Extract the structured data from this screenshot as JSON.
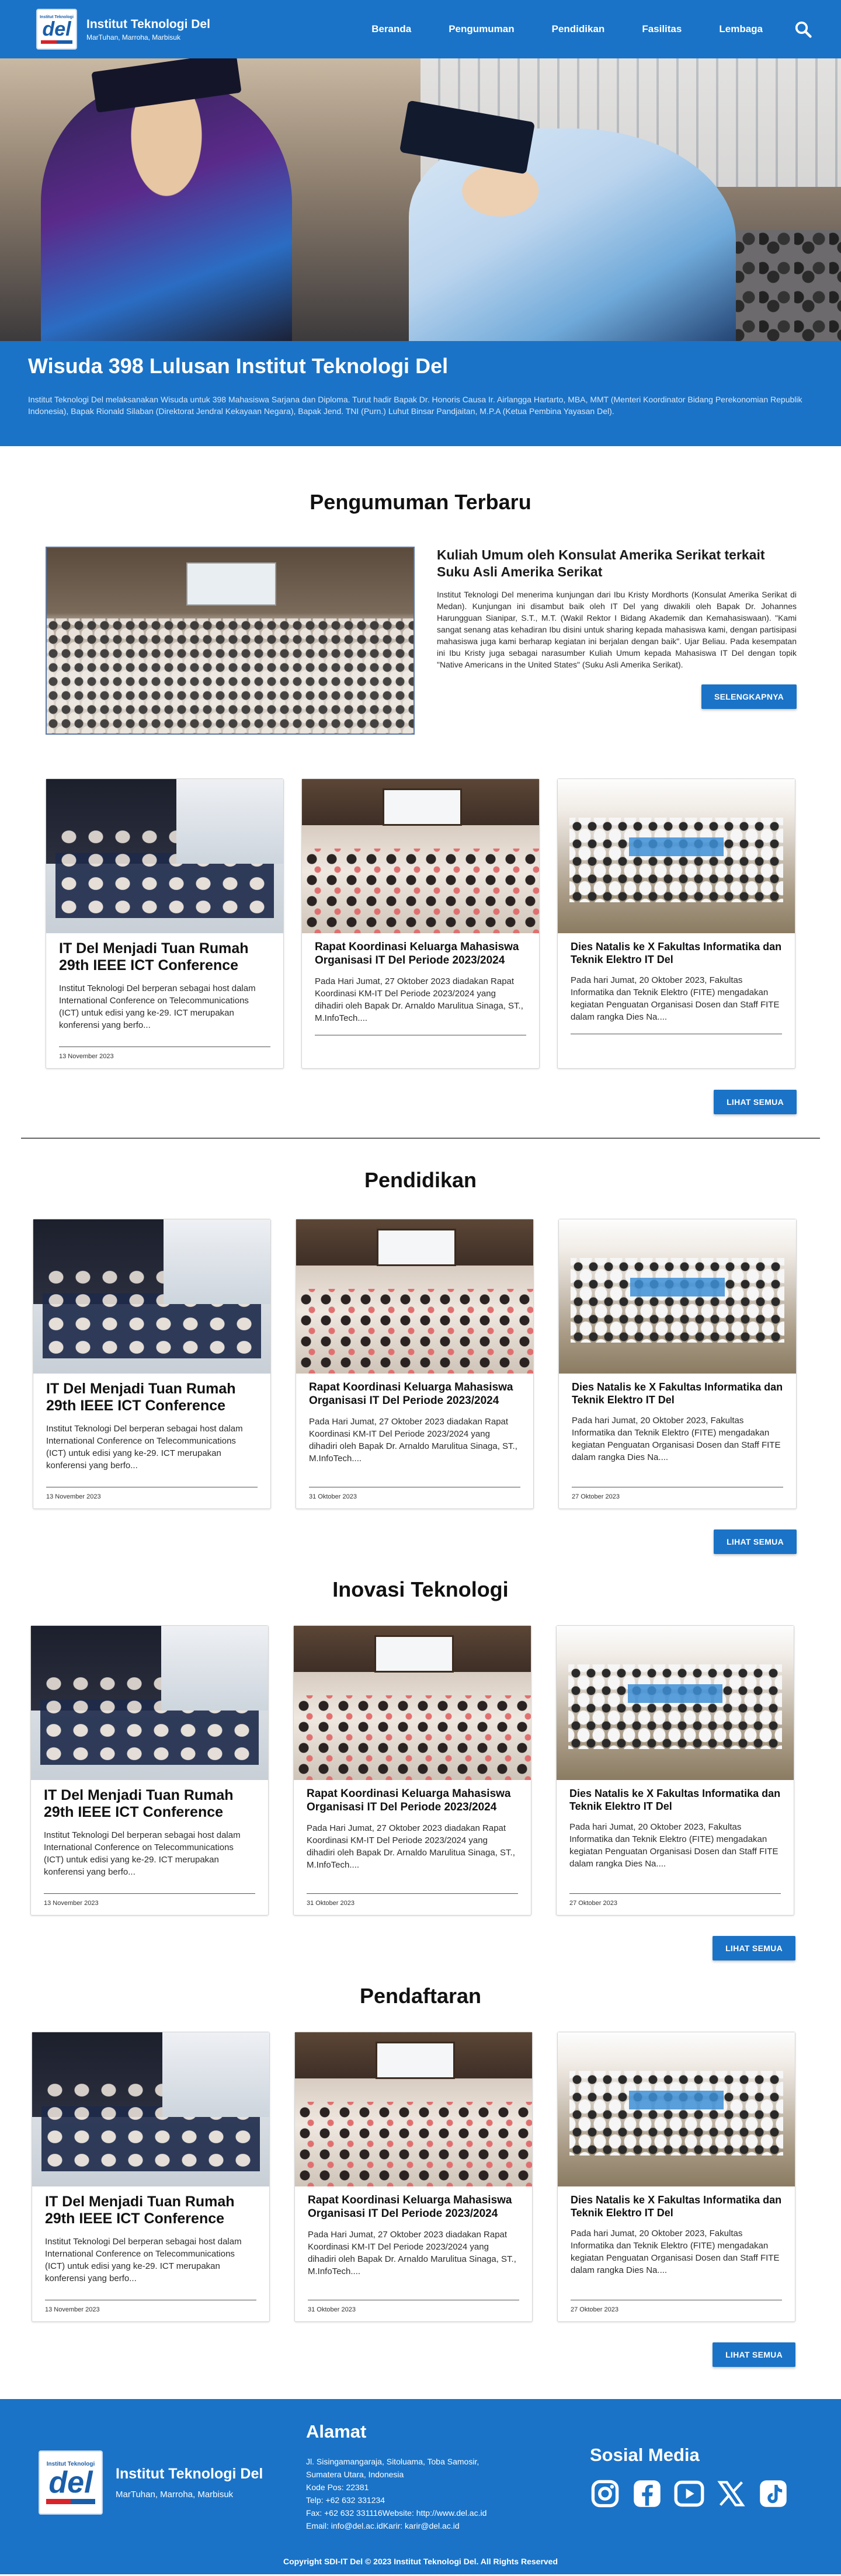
{
  "nav": {
    "brand_name": "Institut Teknologi Del",
    "brand_motto": "MarTuhan, Marroha, Marbisuk",
    "logo_top": "Institut Teknologi",
    "logo_text": "del",
    "links": [
      "Beranda",
      "Pengumuman",
      "Pendidikan",
      "Fasilitas",
      "Lembaga"
    ]
  },
  "hero": {
    "title": "Wisuda 398 Lulusan Institut Teknologi Del",
    "description": "Institut Teknologi Del melaksanakan Wisuda untuk 398 Mahasiswa Sarjana dan Diploma. Turut hadir Bapak Dr. Honoris Causa Ir. Airlangga Hartarto, MBA, MMT (Menteri Koordinator Bidang Perekonomian Republik Indonesia), Bapak Rionald Silaban (Direktorat Jendral Kekayaan Negara), Bapak Jend. TNI (Purn.) Luhut Binsar Pandjaitan, M.P.A (Ketua Pembina Yayasan Del)."
  },
  "announcements": {
    "title": "Pengumuman Terbaru",
    "featured": {
      "title": "Kuliah Umum oleh Konsulat Amerika Serikat terkait Suku Asli Amerika Serikat",
      "text": "Institut Teknologi Del menerima kunjungan dari Ibu Kristy Mordhorts (Konsulat Amerika Serikat di Medan). Kunjungan ini disambut baik oleh IT Del yang diwakili oleh Bapak Dr. Johannes Harungguan Sianipar, S.T., M.T. (Wakil Rektor I Bidang Akademik dan Kemahasiswaan). \"Kami sangat senang atas kehadiran Ibu disini untuk sharing kepada mahasiswa kami, dengan partisipasi mahasiswa juga kami berharap kegiatan ini berjalan dengan baik\". Ujar Beliau. Pada kesempatan ini Ibu Kristy juga sebagai narasumber Kuliah Umum kepada Mahasiswa IT Del dengan topik \"Native Americans in the United States\" (Suku Asli Amerika Serikat).",
      "button": "SELENGKAPNYA"
    },
    "cards": [
      {
        "title": "IT Del Menjadi Tuan Rumah 29th IEEE ICT Conference",
        "text": "Institut Teknologi Del berperan sebagai host dalam International Conference on Telecommunications (ICT) untuk edisi yang ke-29. ICT merupakan konferensi yang berfo...",
        "date": "13 November 2023"
      },
      {
        "title": "Rapat Koordinasi Keluarga Mahasiswa Organisasi IT Del Periode 2023/2024",
        "text": "Pada Hari Jumat, 27 Oktober 2023 diadakan Rapat Koordinasi KM-IT Del Periode 2023/2024 yang dihadiri oleh Bapak Dr. Arnaldo Marulitua Sinaga, ST., M.InfoTech....",
        "date": ""
      },
      {
        "title": "Dies Natalis ke X Fakultas Informatika dan Teknik Elektro IT Del",
        "text": "Pada hari Jumat, 20 Oktober 2023, Fakultas Informatika dan Teknik Elektro (FITE) mengadakan kegiatan Penguatan Organisasi Dosen dan Staff FITE dalam rangka Dies Na....",
        "date": ""
      }
    ],
    "button": "LIHAT SEMUA"
  },
  "sections": [
    {
      "title": "Pendidikan",
      "button": "LIHAT SEMUA",
      "cards": [
        {
          "title": "IT Del Menjadi Tuan Rumah 29th IEEE ICT Conference",
          "text": "Institut Teknologi Del berperan sebagai host dalam International Conference on Telecommunications (ICT) untuk edisi yang ke-29. ICT merupakan konferensi yang berfo...",
          "date": "13 November 2023"
        },
        {
          "title": "Rapat Koordinasi Keluarga Mahasiswa Organisasi IT Del Periode 2023/2024",
          "text": "Pada Hari Jumat, 27 Oktober 2023 diadakan Rapat Koordinasi KM-IT Del Periode 2023/2024 yang dihadiri oleh Bapak Dr. Arnaldo Marulitua Sinaga, ST., M.InfoTech....",
          "date": "31 Oktober 2023"
        },
        {
          "title": "Dies Natalis ke X Fakultas Informatika dan Teknik Elektro IT Del",
          "text": "Pada hari Jumat, 20 Oktober 2023, Fakultas Informatika dan Teknik Elektro (FITE) mengadakan kegiatan Penguatan Organisasi Dosen dan Staff FITE dalam rangka Dies Na....",
          "date": "27 Oktober 2023"
        }
      ]
    },
    {
      "title": "Inovasi Teknologi",
      "button": "LIHAT SEMUA",
      "cards": [
        {
          "title": "IT Del Menjadi Tuan Rumah 29th IEEE ICT Conference",
          "text": "Institut Teknologi Del berperan sebagai host dalam International Conference on Telecommunications (ICT) untuk edisi yang ke-29. ICT merupakan konferensi yang berfo...",
          "date": "13 November 2023"
        },
        {
          "title": "Rapat Koordinasi Keluarga Mahasiswa Organisasi IT Del Periode 2023/2024",
          "text": "Pada Hari Jumat, 27 Oktober 2023 diadakan Rapat Koordinasi KM-IT Del Periode 2023/2024 yang dihadiri oleh Bapak Dr. Arnaldo Marulitua Sinaga, ST., M.InfoTech....",
          "date": "31 Oktober 2023"
        },
        {
          "title": "Dies Natalis ke X Fakultas Informatika dan Teknik Elektro IT Del",
          "text": "Pada hari Jumat, 20 Oktober 2023, Fakultas Informatika dan Teknik Elektro (FITE) mengadakan kegiatan Penguatan Organisasi Dosen dan Staff FITE dalam rangka Dies Na....",
          "date": "27 Oktober 2023"
        }
      ]
    },
    {
      "title": "Pendaftaran",
      "button": "LIHAT SEMUA",
      "cards": [
        {
          "title": "IT Del Menjadi Tuan Rumah 29th IEEE ICT Conference",
          "text": "Institut Teknologi Del berperan sebagai host dalam International Conference on Telecommunications (ICT) untuk edisi yang ke-29. ICT merupakan konferensi yang berfo...",
          "date": "13 November 2023"
        },
        {
          "title": "Rapat Koordinasi Keluarga Mahasiswa Organisasi IT Del Periode 2023/2024",
          "text": "Pada Hari Jumat, 27 Oktober 2023 diadakan Rapat Koordinasi KM-IT Del Periode 2023/2024 yang dihadiri oleh Bapak Dr. Arnaldo Marulitua Sinaga, ST., M.InfoTech....",
          "date": "31 Oktober 2023"
        },
        {
          "title": "Dies Natalis ke X Fakultas Informatika dan Teknik Elektro IT Del",
          "text": "Pada hari Jumat, 20 Oktober 2023, Fakultas Informatika dan Teknik Elektro (FITE) mengadakan kegiatan Penguatan Organisasi Dosen dan Staff FITE dalam rangka Dies Na....",
          "date": "27 Oktober 2023"
        }
      ]
    }
  ],
  "footer": {
    "brand_name": "Institut Teknologi Del",
    "brand_motto": "MarTuhan, Marroha, Marbisuk",
    "address_title": "Alamat",
    "address_lines": [
      "Jl. Sisingamangaraja, Sitoluama, Toba Samosir,",
      "Sumatera Utara, Indonesia",
      "Kode Pos: 22381",
      "Telp: +62 632 331234",
      "Fax: +62 632 331116Website: http://www.del.ac.id",
      "Email: info@del.ac.idKarir: karir@del.ac.id"
    ],
    "social_title": "Sosial Media",
    "social_icons": [
      "instagram-icon",
      "facebook-icon",
      "youtube-icon",
      "x-icon",
      "tiktok-icon"
    ],
    "copyright": "Copyright SDI-IT Del © 2023 Institut Teknologi Del. All Rights Reserved"
  },
  "colors": {
    "primary": "#1a73c7",
    "text": "#111111",
    "background": "#ffffff"
  }
}
